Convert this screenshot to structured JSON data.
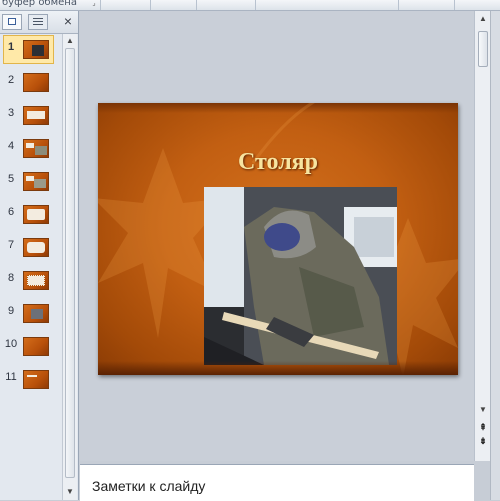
{
  "ribbon": {
    "group_label": "буфер обмена"
  },
  "left_panel": {
    "tabs": [
      {
        "name": "slides-tab-icon"
      },
      {
        "name": "outline-tab-icon"
      }
    ],
    "close_glyph": "×",
    "slides": [
      {
        "number": "1",
        "active": true
      },
      {
        "number": "2"
      },
      {
        "number": "3"
      },
      {
        "number": "4"
      },
      {
        "number": "5"
      },
      {
        "number": "6"
      },
      {
        "number": "7"
      },
      {
        "number": "8"
      },
      {
        "number": "9"
      },
      {
        "number": "10"
      },
      {
        "number": "11"
      }
    ]
  },
  "slide": {
    "title": "Столяр"
  },
  "notes": {
    "placeholder": "Заметки к слайду"
  },
  "colors": {
    "slide_orange": "#c25f12",
    "title_gold": "#f7e4a0",
    "selection": "#ffe9a8"
  }
}
